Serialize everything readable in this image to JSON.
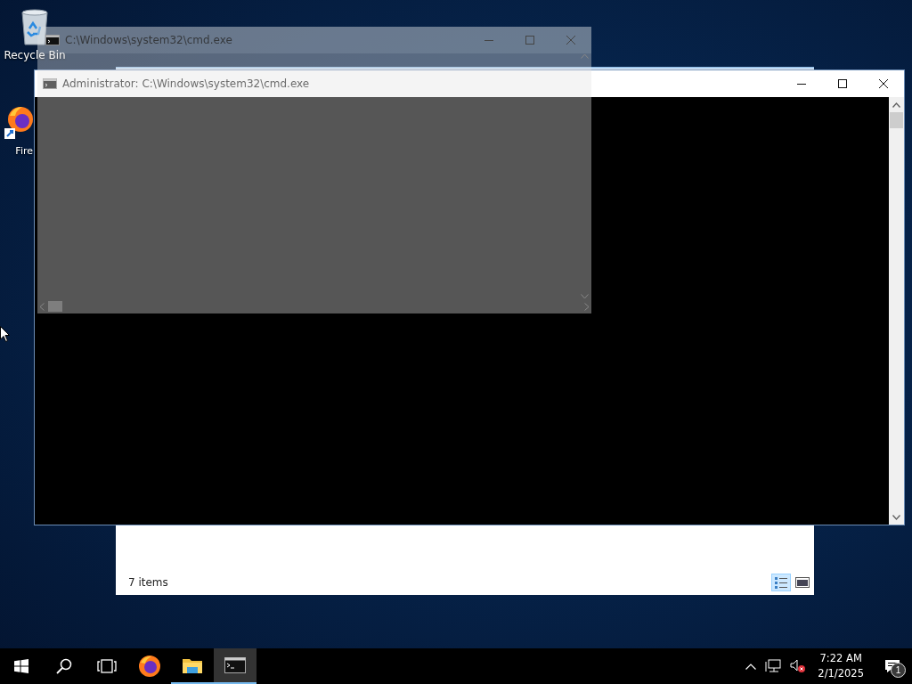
{
  "desktop_icons": [
    {
      "kind": "recycle",
      "label": "Recycle Bin"
    },
    {
      "kind": "firefox",
      "label": "Fire"
    }
  ],
  "explorer_window": {
    "status": "7 items",
    "views": [
      {
        "kind": "details",
        "selected": true
      },
      {
        "kind": "preview",
        "selected": false
      }
    ]
  },
  "cmd_window": {
    "title": "Administrator: C:\\Windows\\system32\\cmd.exe"
  },
  "ghost_window": {
    "title": "C:\\Windows\\system32\\cmd.exe"
  },
  "taskbar": {
    "apps": [
      {
        "kind": "firefox",
        "running": false,
        "selected": false
      },
      {
        "kind": "explorer",
        "running": true,
        "selected": false
      },
      {
        "kind": "cmd",
        "running": true,
        "selected": true
      }
    ],
    "time": "7:22 AM",
    "date": "2/1/2025",
    "notifications": "1"
  }
}
